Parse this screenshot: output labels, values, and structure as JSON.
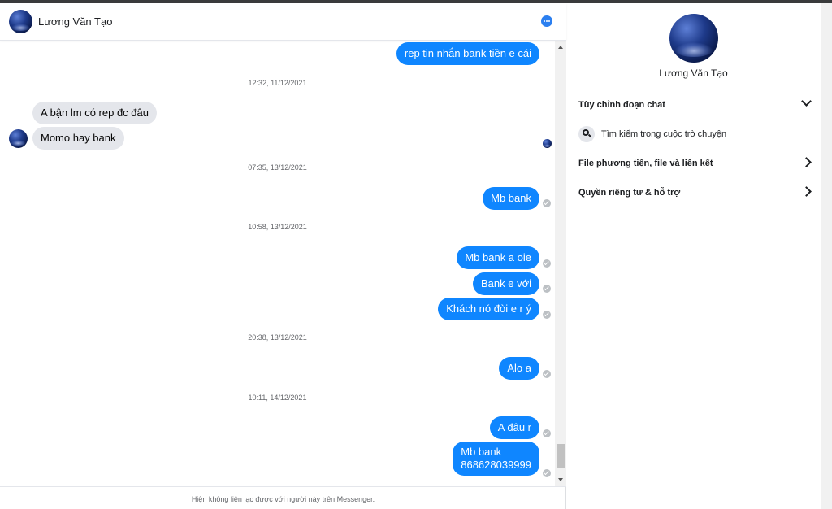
{
  "header": {
    "contact_name": "Lương Văn Tạo",
    "more_icon": "more-options-icon"
  },
  "messages": [
    {
      "kind": "out",
      "text": "rep tin nhắn bank tiền e cái"
    },
    {
      "kind": "timestamp",
      "text": "12:32, 11/12/2021"
    },
    {
      "kind": "in",
      "text": "A bận lm có rep đc đâu"
    },
    {
      "kind": "in",
      "text": "Momo hay bank"
    },
    {
      "kind": "timestamp",
      "text": "07:35, 13/12/2021"
    },
    {
      "kind": "out",
      "text": "Mb bank"
    },
    {
      "kind": "timestamp",
      "text": "10:58, 13/12/2021"
    },
    {
      "kind": "out",
      "text": "Mb bank a oie"
    },
    {
      "kind": "out",
      "text": "Bank e với"
    },
    {
      "kind": "out",
      "text": "Khách nó đòi e r ý"
    },
    {
      "kind": "timestamp",
      "text": "20:38, 13/12/2021"
    },
    {
      "kind": "out",
      "text": "Alo a"
    },
    {
      "kind": "timestamp",
      "text": "10:11, 14/12/2021"
    },
    {
      "kind": "out",
      "text": "A đâu r"
    },
    {
      "kind": "out",
      "text": "Mb bank"
    },
    {
      "kind": "out",
      "text": "868628039999"
    }
  ],
  "footer": {
    "notice": "Hiện không liên lạc được với người này trên Messenger."
  },
  "panel": {
    "name": "Lương Văn Tạo",
    "customize": "Tùy chỉnh đoạn chat",
    "search": "Tìm kiếm trong cuộc trò chuyện",
    "media": "File phương tiện, file và liên kết",
    "privacy": "Quyền riêng tư & hỗ trợ"
  },
  "colors": {
    "outgoing_bubble": "#0f86ff",
    "incoming_bubble": "#e4e6eb",
    "accent": "#2b7ff0"
  }
}
